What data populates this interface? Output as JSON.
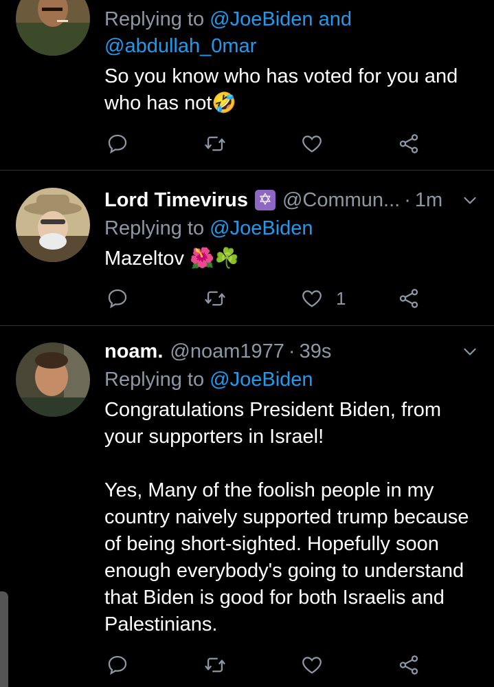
{
  "colors": {
    "background": "#000000",
    "text": "#ffffff",
    "muted": "#8b98a5",
    "link": "#1d9bf0",
    "divider": "#2f3336"
  },
  "tweets": [
    {
      "replying_prefix": "Replying to ",
      "replying_to_1": "@JoeBiden",
      "replying_and": " and",
      "replying_to_2": "@abdullah_0mar",
      "text": "So you know who has voted for you and who has not🤣",
      "actions": {
        "reply_icon": "comment-icon",
        "retweet_icon": "retweet-icon",
        "like_icon": "heart-icon",
        "share_icon": "share-icon"
      }
    },
    {
      "name": "Lord Timevirus",
      "badge": "✡",
      "handle": "@Commun...",
      "dot": "·",
      "time": "1m",
      "replying_prefix": "Replying to ",
      "replying_to_1": "@JoeBiden",
      "text": "Mazeltov 🌺☘️",
      "like_count": "1"
    },
    {
      "name": "noam.",
      "handle": "@noam1977",
      "dot": "·",
      "time": "39s",
      "replying_prefix": "Replying to ",
      "replying_to_1": "@JoeBiden",
      "text": "Congratulations President Biden, from your supporters in Israel!\n\nYes, Many of the foolish people in my country naively supported trump because of being short-sighted. Hopefully soon enough everybody's going to understand that Biden is good for both Israelis and Palestinians."
    }
  ]
}
